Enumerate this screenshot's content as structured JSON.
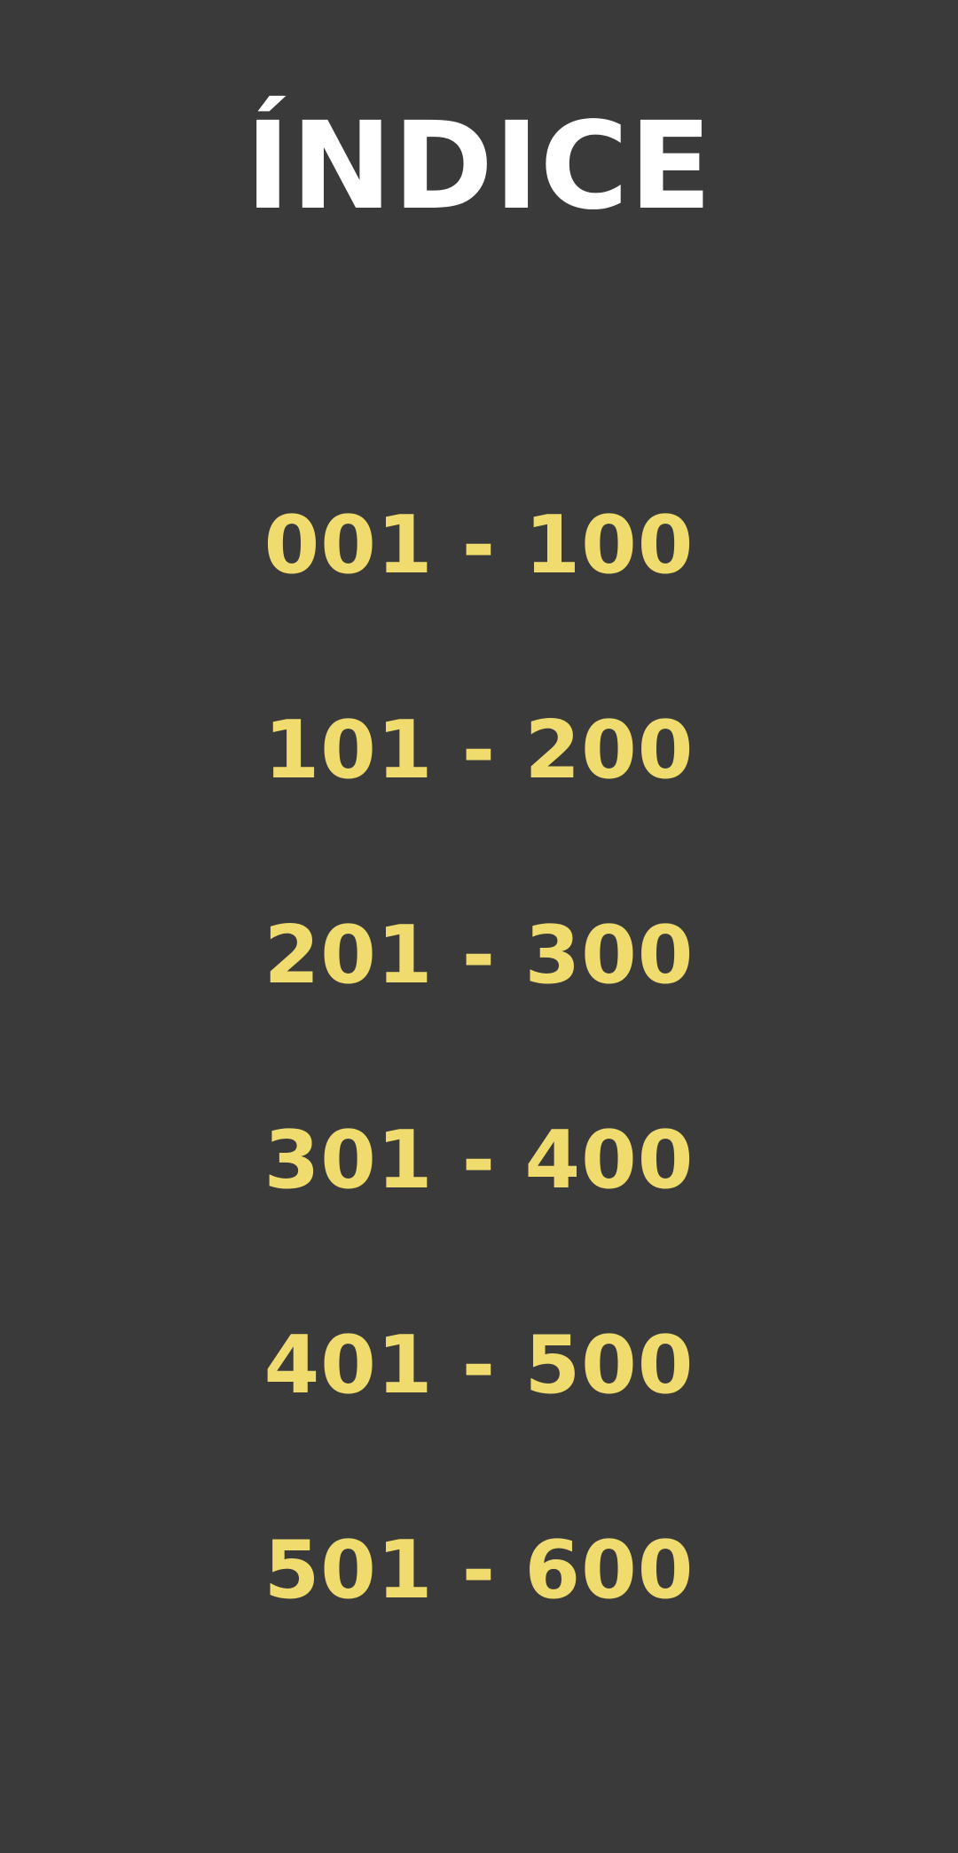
{
  "header": {
    "title": "ÍNDICE"
  },
  "index": {
    "items": [
      {
        "label": "001 - 100"
      },
      {
        "label": "101 - 200"
      },
      {
        "label": "201 - 300"
      },
      {
        "label": "301 - 400"
      },
      {
        "label": "401 - 500"
      },
      {
        "label": "501 - 600"
      }
    ]
  },
  "colors": {
    "background": "#3a3a3a",
    "title": "#ffffff",
    "link": "#f0dc6e"
  }
}
